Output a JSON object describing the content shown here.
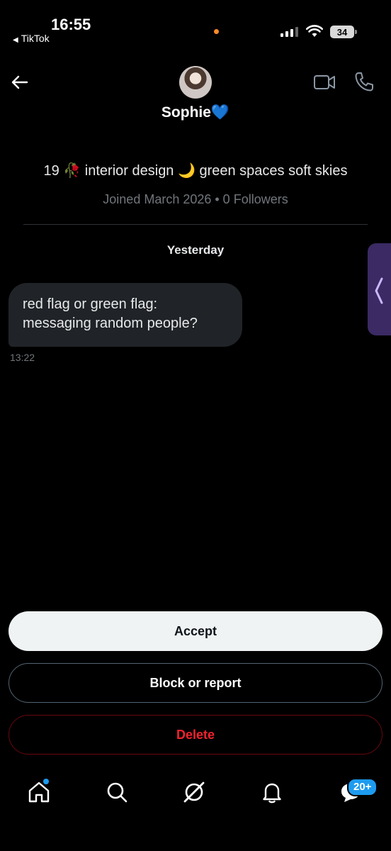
{
  "status_bar": {
    "time": "16:55",
    "back_app": "TikTok",
    "battery": "34"
  },
  "profile": {
    "name": "Sophie💙",
    "bio": "19 🥀 interior design 🌙 green spaces soft skies",
    "joined": "Joined March 2026 • 0 Followers"
  },
  "conversation": {
    "day_label": "Yesterday",
    "messages": [
      {
        "text": "red flag or green flag: messaging random people?",
        "time": "13:22"
      }
    ]
  },
  "actions": {
    "accept": "Accept",
    "block": "Block or report",
    "delete": "Delete"
  },
  "nav": {
    "messages_badge": "20+"
  },
  "colors": {
    "accent": "#1d9bf0",
    "danger": "#f4212e",
    "bubble": "#202327",
    "side_handle": "#3b2a63"
  }
}
